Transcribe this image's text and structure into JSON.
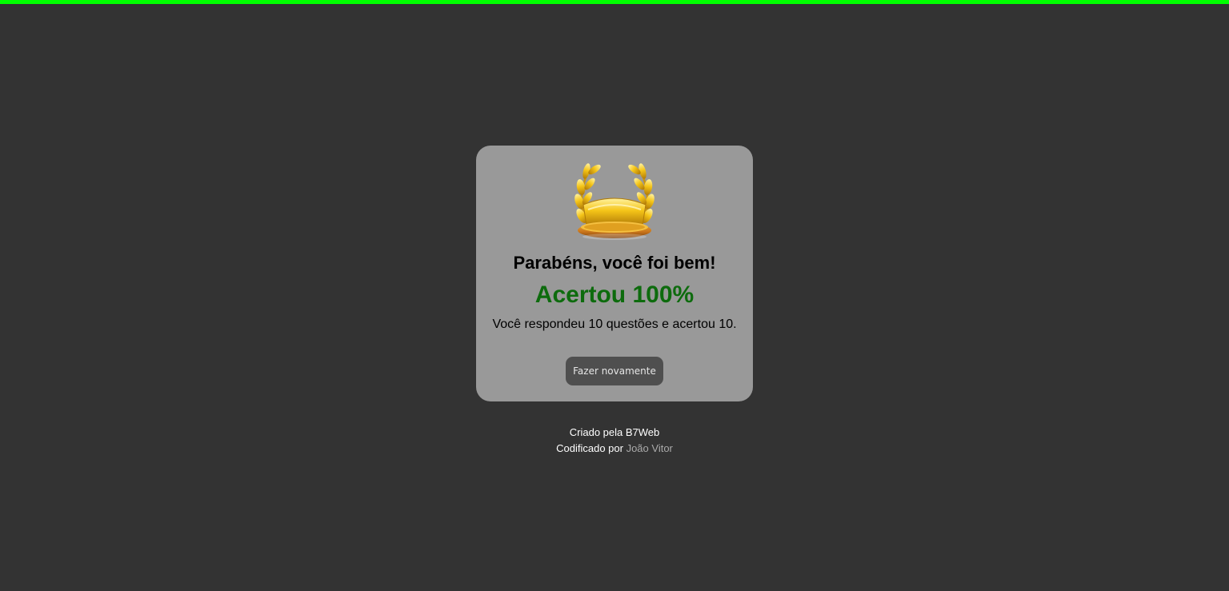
{
  "progress": {
    "value_percent": 100,
    "color": "#00ff00"
  },
  "result": {
    "icon": "trophy-laurel-icon",
    "title": "Parabéns, você foi bem!",
    "score_text": "Acertou 100%",
    "score_color": "#0d6b0d",
    "description": "Você respondeu 10 questões e acertou 10.",
    "retry_label": "Fazer novamente"
  },
  "footer": {
    "created_by": "Criado pela B7Web",
    "coded_by_prefix": "Codificado por",
    "author": "João Vitor"
  }
}
